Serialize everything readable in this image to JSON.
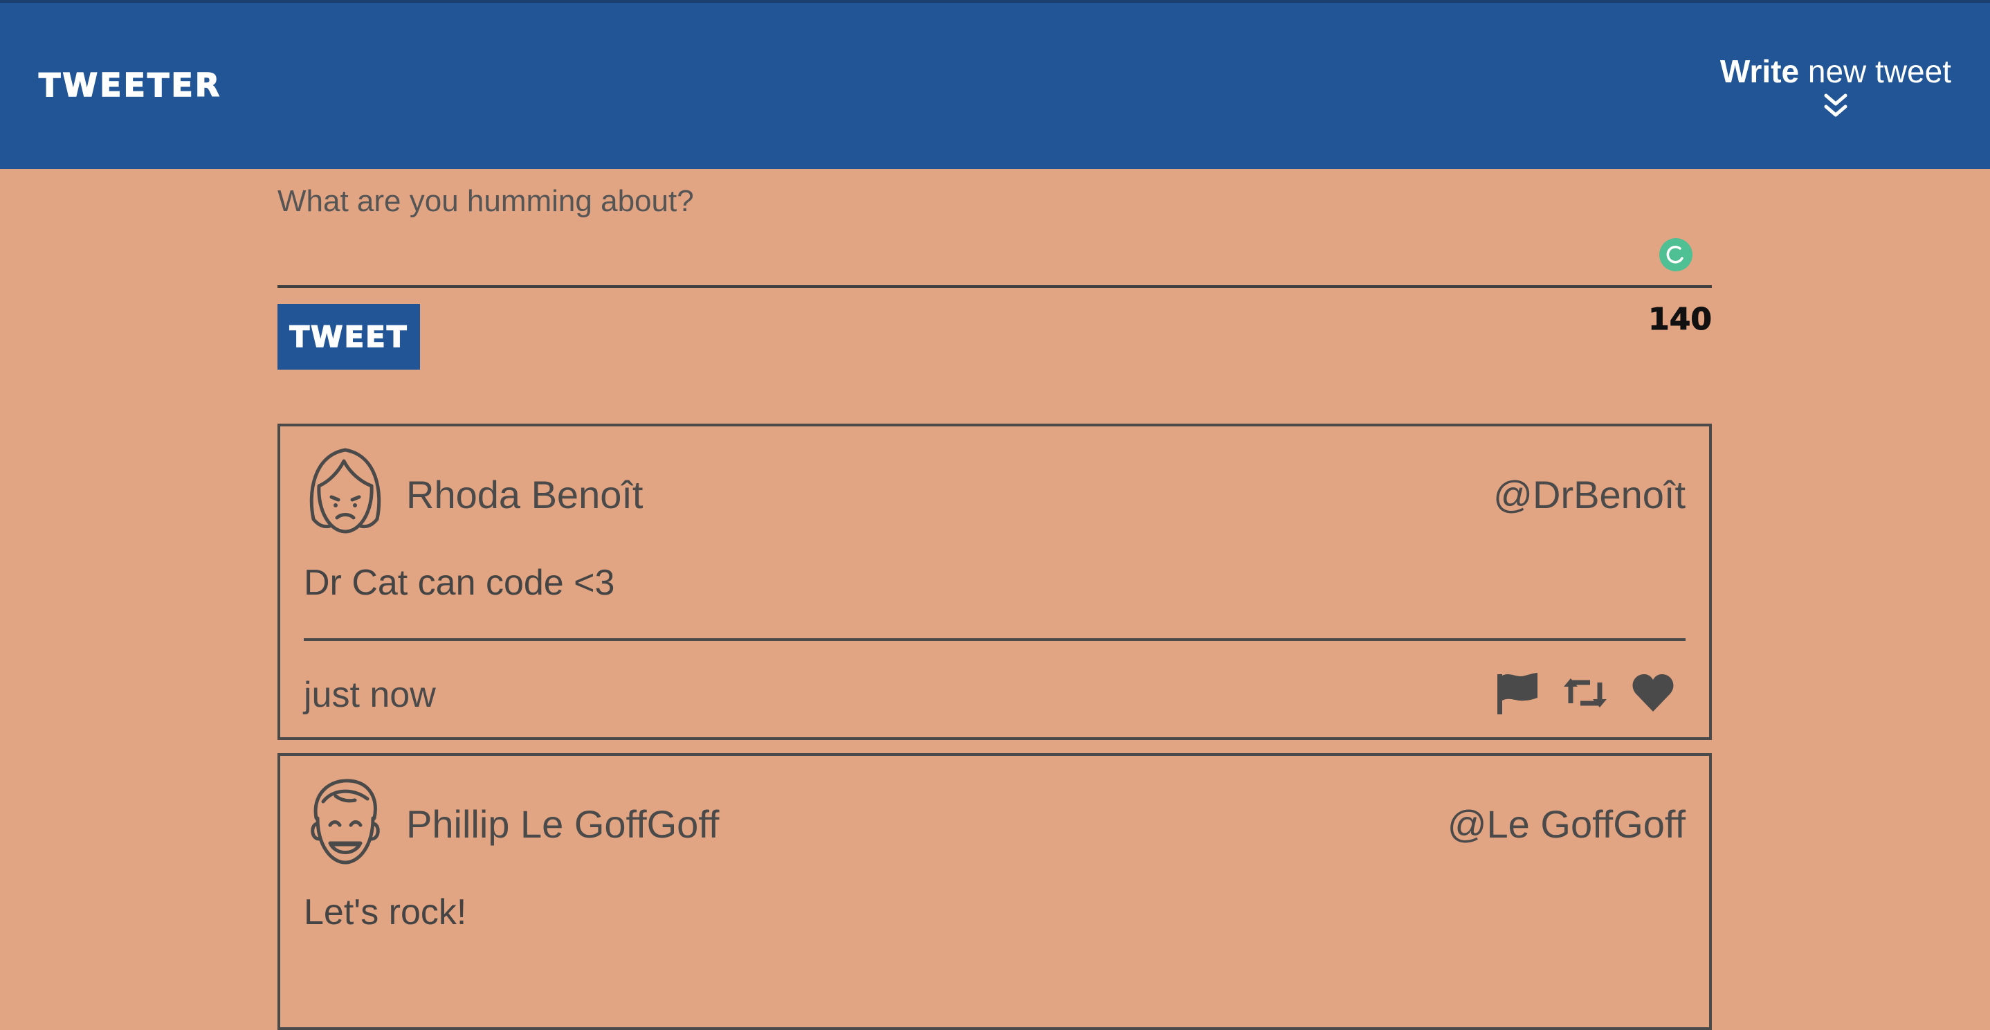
{
  "nav": {
    "brand": "TWEETER",
    "compose_toggle_bold": "Write",
    "compose_toggle_rest": " new tweet",
    "compose_toggle_icon": "double-chevron-down-icon"
  },
  "compose": {
    "placeholder": "What are you humming about?",
    "value": "",
    "submit_label": "TWEET",
    "char_counter": "140",
    "extension_icon": "grammarly-icon"
  },
  "tweets": [
    {
      "name": "Rhoda Benoît",
      "handle": "@DrBenoît",
      "text": "Dr Cat can code <3",
      "timestamp": "just now",
      "avatar_icon": "woman-avatar-icon",
      "actions": [
        "flag-icon",
        "retweet-icon",
        "heart-icon"
      ]
    },
    {
      "name": "Phillip Le GoffGoff",
      "handle": "@Le GoffGoff",
      "text": "Let's rock!",
      "avatar_icon": "man-avatar-icon"
    }
  ],
  "colors": {
    "nav_background": "#225596",
    "page_background": "#e2a583",
    "text": "#4a4a4a",
    "tweet_button": "#225596",
    "grammarly_badge": "#4fbf94"
  }
}
